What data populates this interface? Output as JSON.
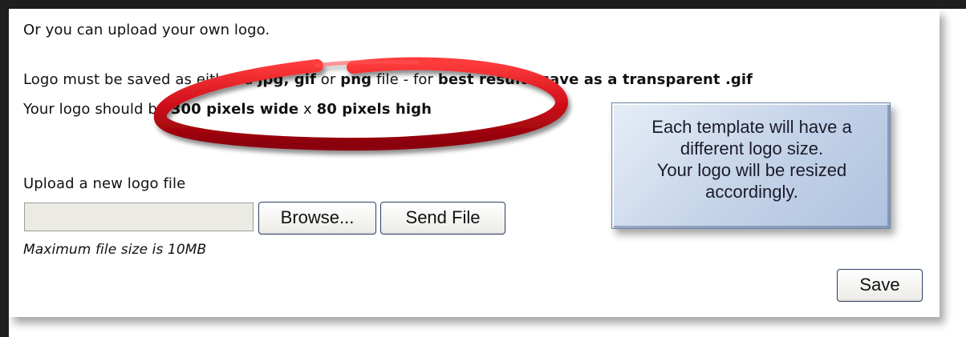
{
  "intro": "Or you can upload your own logo.",
  "format_line": {
    "prefix": "Logo must be saved as either a ",
    "jpg": "jpg,",
    "gif": " gif",
    "or": " or ",
    "png": "png",
    "mid": " file - for ",
    "best": "best results save as a transparent .gif"
  },
  "size_line": {
    "prefix": "Your logo should be ",
    "width": "300 pixels wide",
    "x": " x ",
    "height": "80 pixels high"
  },
  "note": {
    "text": "Each template will have a\ndifferent logo size.\nYour logo will be resized\naccordingly."
  },
  "upload": {
    "label": "Upload a new logo file",
    "file_value": "",
    "browse_label": "Browse...",
    "send_label": "Send File",
    "max_size": "Maximum file size is 10MB"
  },
  "save_label": "Save",
  "colors": {
    "annotation_ring": "#d0101a",
    "note_bg": "#c3d2e8",
    "frame": "#1e1e1e"
  }
}
